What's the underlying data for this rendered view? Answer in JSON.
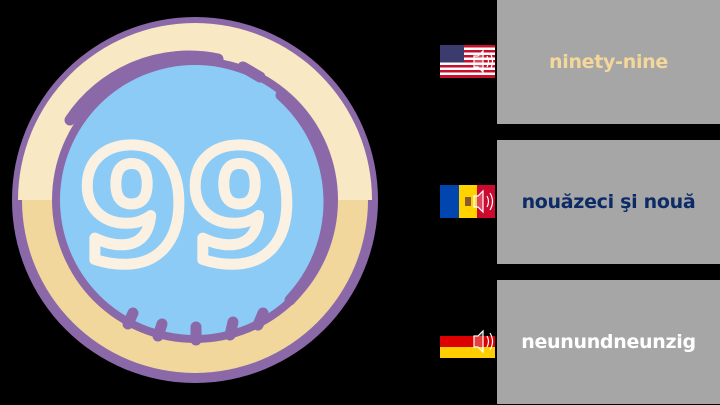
{
  "badge": {
    "number": "99",
    "icon": "number-99-clock-icon",
    "colors": {
      "ring": "#8b69a8",
      "rim": "#f2d79c",
      "face": "#8ccbf6",
      "digits": "#fbf1e2"
    }
  },
  "translations": [
    {
      "language_icon": "us-flag-speaker-icon",
      "text": "ninety-nine",
      "text_color": "#f4d79a"
    },
    {
      "language_icon": "moldova-flag-speaker-icon",
      "text": "nouăzeci şi nouă",
      "text_color": "#0b2a66"
    },
    {
      "language_icon": "germany-flag-speaker-icon",
      "text": "neunundneunzig",
      "text_color": "#ffffff"
    }
  ],
  "colors": {
    "background": "#000000",
    "panel": "#a6a6a6"
  }
}
